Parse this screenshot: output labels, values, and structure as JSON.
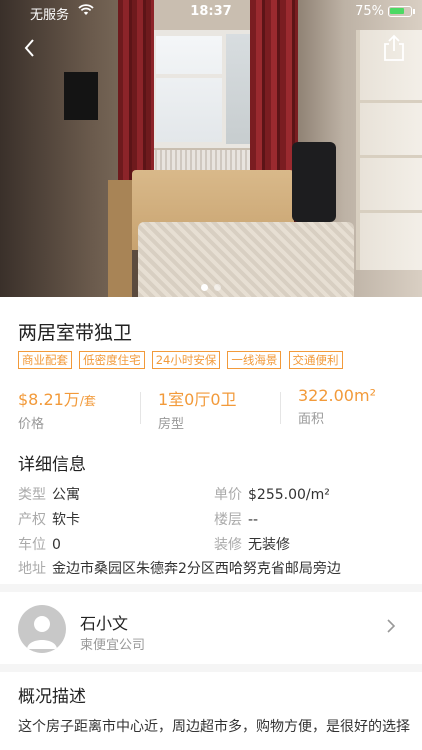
{
  "status_bar": {
    "carrier": "无服务",
    "time": "18:37",
    "battery_percent": "75%",
    "battery_level": 0.75,
    "battery_color": "#4cd964"
  },
  "nav": {
    "back_icon": "chevron-left-icon",
    "share_icon": "share-icon"
  },
  "gallery": {
    "page_count": 2,
    "current_page": 1
  },
  "listing": {
    "title": "两居室带独卫",
    "tags": [
      "商业配套",
      "低密度住宅",
      "24小时安保",
      "一线海景",
      "交通便利"
    ],
    "accent_color": "#f29a3a"
  },
  "stats": {
    "price_value": "$8.21万",
    "price_unit": "/套",
    "price_label": "价格",
    "layout_value": "1室0厅0卫",
    "layout_label": "房型",
    "area_value": "322.00m²",
    "area_label": "面积"
  },
  "details": {
    "title": "详细信息",
    "type_label": "类型",
    "type_value": "公寓",
    "unit_price_label": "单价",
    "unit_price_value": "$255.00/m²",
    "property_label": "产权",
    "property_value": "软卡",
    "floor_label": "楼层",
    "floor_value": "--",
    "parking_label": "车位",
    "parking_value": "0",
    "decoration_label": "装修",
    "decoration_value": "无装修",
    "address_label": "地址",
    "address_value": "金边市桑园区朱德奔2分区西哈努克省邮局旁边"
  },
  "agent": {
    "name": "石小文",
    "company": "柬便宜公司"
  },
  "overview": {
    "title": "概况描述",
    "text": "这个房子距离市中心近，周边超市多，购物方便，是很好的选择"
  }
}
